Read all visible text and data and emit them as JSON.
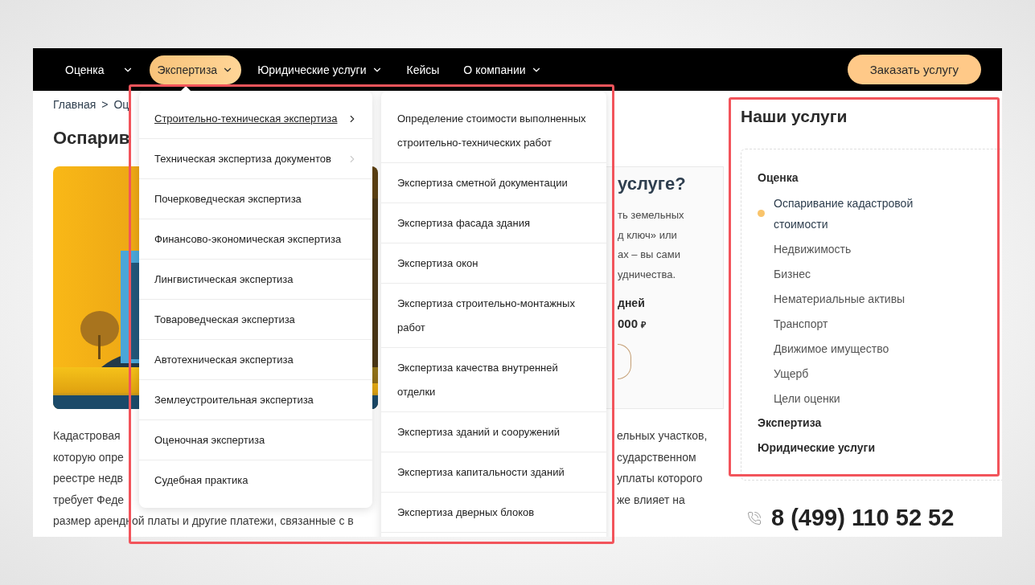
{
  "nav": {
    "items": [
      {
        "label": "Оценка",
        "selected": false,
        "has_menu": true
      },
      {
        "label": "Экспертиза",
        "selected": true,
        "has_menu": true
      },
      {
        "label": "Юридические услуги",
        "selected": false,
        "has_menu": true
      },
      {
        "label": "Кейсы",
        "selected": false,
        "has_menu": false
      },
      {
        "label": "О компании",
        "selected": false,
        "has_menu": true
      }
    ],
    "cta": "Заказать услугу"
  },
  "breadcrumb": [
    "Главная",
    ">",
    "Оц"
  ],
  "title_fragment": "Оспарив",
  "hero": {
    "card": {
      "title_fragment": "услуге?",
      "lines": [
        "ть земельных",
        "д ключ» или",
        "ах – вы сами",
        "удничества."
      ],
      "duration_fragment": "дней",
      "price_fragment": "000",
      "currency": "₽"
    }
  },
  "paragraph": [
    {
      "left": "Кадастровая",
      "right": "ельных участков,"
    },
    {
      "left": "которую опре",
      "right": "сударственном"
    },
    {
      "left": "реестре недв",
      "right": "уплаты которого"
    },
    {
      "left": "требует Феде",
      "right": "же влияет на"
    },
    {
      "left": "размер арендной платы и другие платежи, связанные с в"
    }
  ],
  "dropdown": {
    "categories": [
      {
        "label": "Строительно-техническая экспертиза",
        "selected": true,
        "has_submenu": true
      },
      {
        "label": "Техническая экспертиза документов",
        "selected": false,
        "has_submenu": true
      },
      {
        "label": "Почерковедческая экспертиза",
        "selected": false,
        "has_submenu": false
      },
      {
        "label": "Финансово-экономическая экспертиза",
        "selected": false,
        "has_submenu": false
      },
      {
        "label": "Лингвистическая экспертиза",
        "selected": false,
        "has_submenu": false
      },
      {
        "label": "Товароведческая экспертиза",
        "selected": false,
        "has_submenu": false
      },
      {
        "label": "Автотехническая экспертиза",
        "selected": false,
        "has_submenu": false
      },
      {
        "label": "Землеустроительная экспертиза",
        "selected": false,
        "has_submenu": false
      },
      {
        "label": "Оценочная экспертиза",
        "selected": false,
        "has_submenu": false
      },
      {
        "label": "Судебная практика",
        "selected": false,
        "has_submenu": false
      }
    ],
    "subitems": [
      "Определение стоимости выполненных строительно-технических работ",
      "Экспертиза сметной документации",
      "Экспертиза фасада здания",
      "Экспертиза окон",
      "Экспертиза строительно-монтажных работ",
      "Экспертиза качества внутренней отделки",
      "Экспертиза зданий и сооружений",
      "Экспертиза капитальности зданий",
      "Экспертиза дверных блоков"
    ]
  },
  "sidebar": {
    "title": "Наши услуги",
    "tree": [
      {
        "label": "Оценка",
        "children": [
          {
            "label": "Оспаривание кадастровой стоимости",
            "selected": true
          },
          {
            "label": "Недвижимость",
            "selected": false
          },
          {
            "label": "Бизнес",
            "selected": false
          },
          {
            "label": "Нематериальные активы",
            "selected": false
          },
          {
            "label": "Транспорт",
            "selected": false
          },
          {
            "label": "Движимое имущество",
            "selected": false
          },
          {
            "label": "Ущерб",
            "selected": false
          },
          {
            "label": "Цели оценки",
            "selected": false
          }
        ]
      },
      {
        "label": "Экспертиза"
      },
      {
        "label": "Юридические услуги"
      }
    ]
  },
  "phone": "8 (499) 110 52 52"
}
